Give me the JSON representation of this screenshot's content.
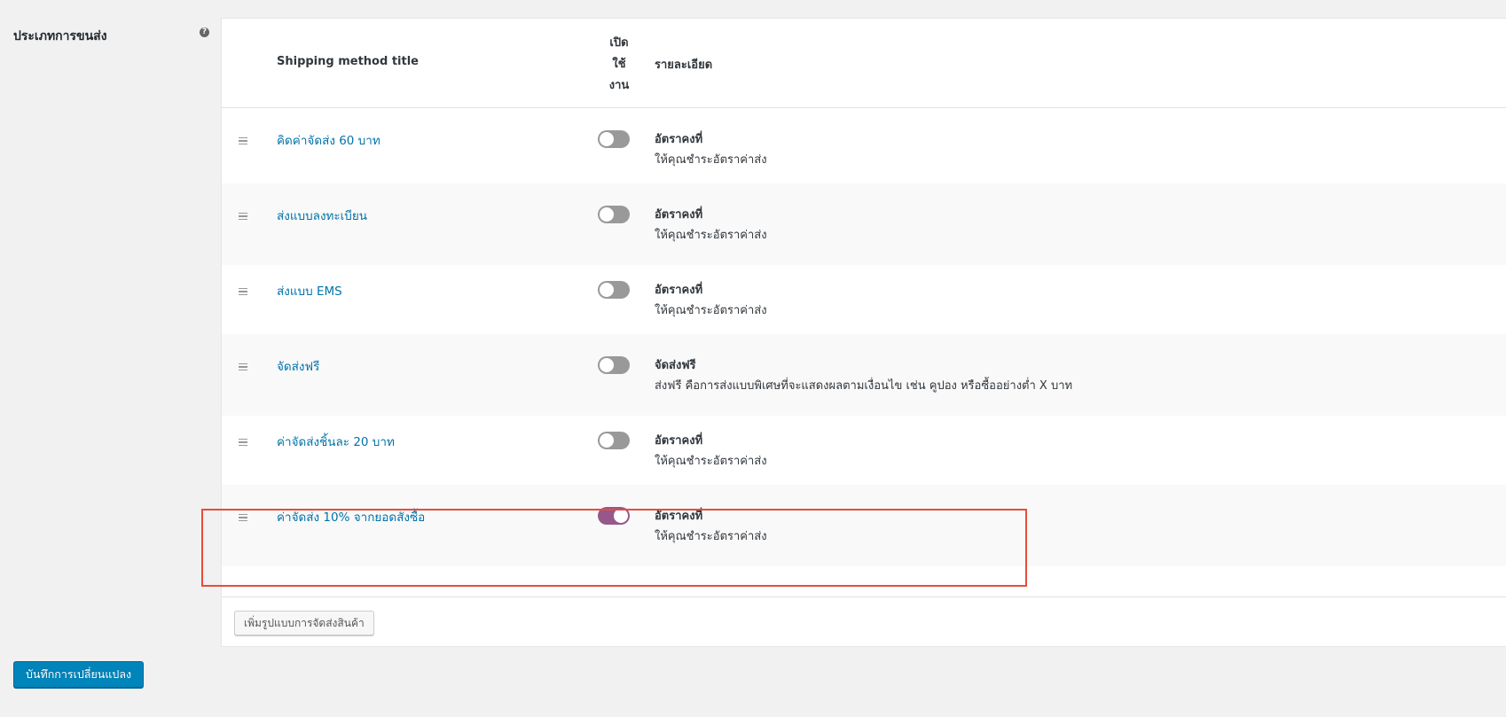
{
  "section": {
    "label": "ประเภทการขนส่ง",
    "help_icon": "?"
  },
  "table": {
    "headers": {
      "title": "Shipping method title",
      "enabled": "เปิด\nใช้\nงาน",
      "description": "รายละเอียด"
    },
    "rows": [
      {
        "title": "คิดค่าจัดส่ง 60 บาท",
        "enabled": false,
        "desc_title": "อัตราคงที่",
        "desc_text": "ให้คุณชำระอัตราค่าส่ง"
      },
      {
        "title": "ส่งแบบลงทะเบียน",
        "enabled": false,
        "desc_title": "อัตราคงที่",
        "desc_text": "ให้คุณชำระอัตราค่าส่ง"
      },
      {
        "title": "ส่งแบบ EMS",
        "enabled": false,
        "desc_title": "อัตราคงที่",
        "desc_text": "ให้คุณชำระอัตราค่าส่ง"
      },
      {
        "title": "จัดส่งฟรี",
        "enabled": false,
        "desc_title": "จัดส่งฟรี",
        "desc_text": "ส่งฟรี คือการส่งแบบพิเศษที่จะแสดงผลตามเงื่อนไข เช่น คูปอง หรือซื้ออย่างต่ำ X บาท"
      },
      {
        "title": "ค่าจัดส่งชิ้นละ 20 บาท",
        "enabled": false,
        "desc_title": "อัตราคงที่",
        "desc_text": "ให้คุณชำระอัตราค่าส่ง"
      },
      {
        "title": "ค่าจัดส่ง 10% จากยอดสั่งซื้อ",
        "enabled": true,
        "desc_title": "อัตราคงที่",
        "desc_text": "ให้คุณชำระอัตราค่าส่ง"
      }
    ],
    "add_button_label": "เพิ่มรูปแบบการจัดส่งสินค้า"
  },
  "save_button_label": "บันทึกการเปลี่ยนแปลง",
  "colors": {
    "link": "#0073aa",
    "toggle_on": "#96588a",
    "toggle_off": "#999999",
    "primary_button": "#0085ba",
    "highlight": "#e74c3c"
  }
}
